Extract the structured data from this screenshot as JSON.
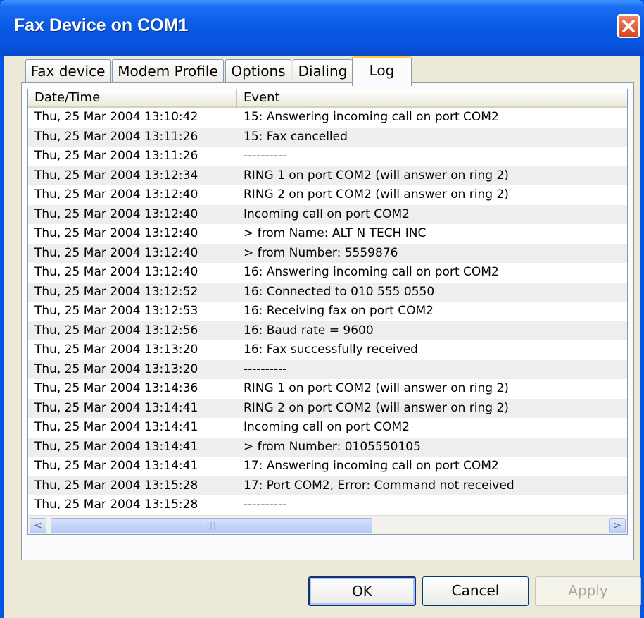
{
  "window": {
    "title": "Fax Device on COM1"
  },
  "tabs": [
    "Fax device",
    "Modem Profile",
    "Options",
    "Dialing",
    "Log"
  ],
  "active_tab": "Log",
  "log": {
    "columns": [
      "Date/Time",
      "Event"
    ],
    "rows": [
      [
        "Thu, 25 Mar 2004 13:10:42",
        "15: Answering incoming call on port COM2"
      ],
      [
        "Thu, 25 Mar 2004 13:11:26",
        "15: Fax cancelled"
      ],
      [
        "Thu, 25 Mar 2004 13:11:26",
        "----------"
      ],
      [
        "Thu, 25 Mar 2004 13:12:34",
        "RING 1 on port COM2 (will answer on ring 2)"
      ],
      [
        "Thu, 25 Mar 2004 13:12:40",
        "RING 2 on port COM2 (will answer on ring 2)"
      ],
      [
        "Thu, 25 Mar 2004 13:12:40",
        "Incoming call on port COM2"
      ],
      [
        "Thu, 25 Mar 2004 13:12:40",
        "> from Name: ALT N TECH INC"
      ],
      [
        "Thu, 25 Mar 2004 13:12:40",
        "> from Number: 5559876"
      ],
      [
        "Thu, 25 Mar 2004 13:12:40",
        "16: Answering incoming call on port COM2"
      ],
      [
        "Thu, 25 Mar 2004 13:12:52",
        "16: Connected to 010 555 0550"
      ],
      [
        "Thu, 25 Mar 2004 13:12:53",
        "16: Receiving fax on port COM2"
      ],
      [
        "Thu, 25 Mar 2004 13:12:56",
        "16: Baud rate = 9600"
      ],
      [
        "Thu, 25 Mar 2004 13:13:20",
        "16: Fax successfully received"
      ],
      [
        "Thu, 25 Mar 2004 13:13:20",
        "----------"
      ],
      [
        "Thu, 25 Mar 2004 13:14:36",
        "RING 1 on port COM2 (will answer on ring 2)"
      ],
      [
        "Thu, 25 Mar 2004 13:14:41",
        "RING 2 on port COM2 (will answer on ring 2)"
      ],
      [
        "Thu, 25 Mar 2004 13:14:41",
        "Incoming call on port COM2"
      ],
      [
        "Thu, 25 Mar 2004 13:14:41",
        "> from Number: 0105550105"
      ],
      [
        "Thu, 25 Mar 2004 13:14:41",
        "17: Answering incoming call on port COM2"
      ],
      [
        "Thu, 25 Mar 2004 13:15:28",
        "17: Port COM2, Error: Command not received"
      ],
      [
        "Thu, 25 Mar 2004 13:15:28",
        "----------"
      ]
    ]
  },
  "scrollbar": {
    "left_arrow": "<",
    "right_arrow": ">",
    "grip": "|||"
  },
  "buttons": {
    "ok": "OK",
    "cancel": "Cancel",
    "apply": "Apply"
  },
  "icons": {
    "close": "close-icon",
    "scroll_left": "arrow-left-icon",
    "scroll_right": "arrow-right-icon"
  },
  "colors": {
    "titlebar": "#0a5ae6",
    "dialog_bg": "#ece9d8",
    "row_stripe": "#eeeeee",
    "active_tab_accent": "#ffc83c",
    "close_button": "#e05a35"
  }
}
